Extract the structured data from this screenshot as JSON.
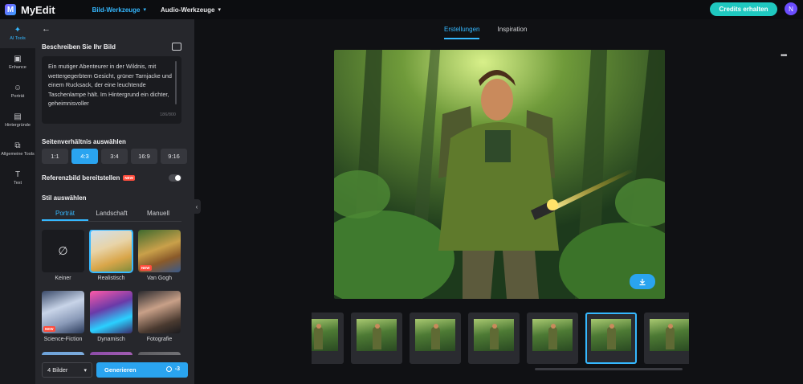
{
  "app": {
    "name": "MyEdit",
    "logo_letter": "M"
  },
  "topnav": [
    {
      "label": "Bild-Werkzeuge",
      "active": true
    },
    {
      "label": "Audio-Werkzeuge",
      "active": false
    }
  ],
  "header": {
    "credits_label": "Credits erhalten",
    "avatar_initial": "N"
  },
  "rail": [
    {
      "label": "AI Tools",
      "icon": "magic-wand-icon",
      "glyph": "✦",
      "active": true
    },
    {
      "label": "Enhance",
      "icon": "enhance-icon",
      "glyph": "▣",
      "active": false
    },
    {
      "label": "Porträt",
      "icon": "portrait-icon",
      "glyph": "☺",
      "active": false
    },
    {
      "label": "Hintergründe",
      "icon": "background-icon",
      "glyph": "▤",
      "active": false
    },
    {
      "label": "Allgemeine Tools",
      "icon": "tools-icon",
      "glyph": "⧉",
      "active": false
    },
    {
      "label": "Text",
      "icon": "text-icon",
      "glyph": "T",
      "active": false
    }
  ],
  "panel": {
    "back_icon": "←",
    "describe_label": "Beschreiben Sie Ihr Bild",
    "prompt": "Ein mutiger Abenteurer in der Wildnis, mit wettergegerbtem Gesicht, grüner Tarnjacke und einem Rucksack, der eine leuchtende Taschenlampe hält. Im Hintergrund ein dichter, geheimnisvoller",
    "char_count": "186/800",
    "ratio_label": "Seitenverhältnis auswählen",
    "ratios": [
      {
        "label": "1:1",
        "active": false
      },
      {
        "label": "4:3",
        "active": true
      },
      {
        "label": "3:4",
        "active": false
      },
      {
        "label": "16:9",
        "active": false
      },
      {
        "label": "9:16",
        "active": false
      }
    ],
    "reference_label": "Referenzbild bereitstellen",
    "new_badge": "NEW",
    "reference_enabled": false,
    "style_label": "Stil auswählen",
    "style_tabs": [
      {
        "label": "Porträt",
        "active": true
      },
      {
        "label": "Landschaft",
        "active": false
      },
      {
        "label": "Manuell",
        "active": false
      }
    ],
    "styles": [
      {
        "name": "Keiner",
        "selected": false,
        "new": false
      },
      {
        "name": "Realistisch",
        "selected": true,
        "new": false
      },
      {
        "name": "Van Gogh",
        "selected": false,
        "new": true
      },
      {
        "name": "Science-Fiction",
        "selected": false,
        "new": true
      },
      {
        "name": "Dynamisch",
        "selected": false,
        "new": false
      },
      {
        "name": "Fotografie",
        "selected": false,
        "new": false
      },
      {
        "name": "",
        "selected": false,
        "new": false
      },
      {
        "name": "",
        "selected": false,
        "new": false
      },
      {
        "name": "",
        "selected": false,
        "new": false
      }
    ],
    "none_symbol": "∅",
    "count_select": "4 Bilder",
    "generate_label": "Generieren",
    "generate_cost": "-3"
  },
  "main": {
    "tabs": [
      {
        "label": "Erstellungen",
        "active": true
      },
      {
        "label": "Inspiration",
        "active": false
      }
    ],
    "more_icon": "•••",
    "thumbnails": [
      {
        "selected": false
      },
      {
        "selected": false
      },
      {
        "selected": false
      },
      {
        "selected": false
      },
      {
        "selected": false
      },
      {
        "selected": true
      },
      {
        "selected": false
      }
    ]
  },
  "colors": {
    "accent": "#2aa4f0",
    "teal": "#1fc8c0",
    "new_badge": "#ff4d3d"
  }
}
